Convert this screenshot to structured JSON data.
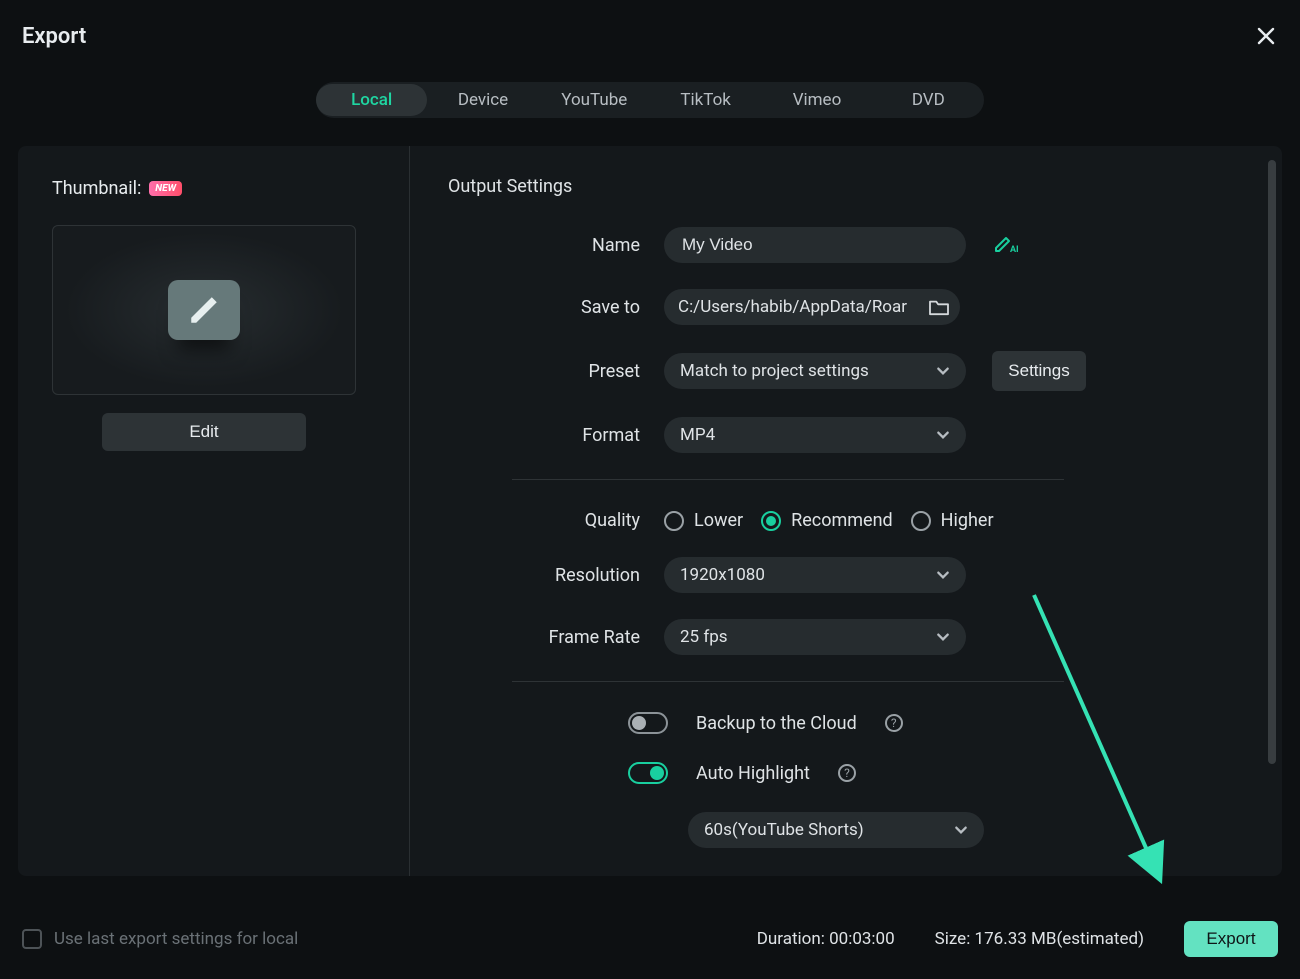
{
  "header": {
    "title": "Export"
  },
  "tabs": [
    "Local",
    "Device",
    "YouTube",
    "TikTok",
    "Vimeo",
    "DVD"
  ],
  "active_tab": "Local",
  "thumbnail": {
    "label": "Thumbnail:",
    "badge": "NEW",
    "edit_label": "Edit"
  },
  "output": {
    "section_title": "Output Settings",
    "name": {
      "label": "Name",
      "value": "My Video"
    },
    "save_to": {
      "label": "Save to",
      "value": "C:/Users/habib/AppData/Roar"
    },
    "preset": {
      "label": "Preset",
      "value": "Match to project settings",
      "settings_label": "Settings"
    },
    "format": {
      "label": "Format",
      "value": "MP4"
    },
    "quality": {
      "label": "Quality",
      "options": [
        "Lower",
        "Recommend",
        "Higher"
      ],
      "selected": "Recommend"
    },
    "resolution": {
      "label": "Resolution",
      "value": "1920x1080"
    },
    "frame_rate": {
      "label": "Frame Rate",
      "value": "25 fps"
    },
    "backup": {
      "label": "Backup to the Cloud",
      "enabled": false
    },
    "highlight": {
      "label": "Auto Highlight",
      "enabled": true,
      "preset": "60s(YouTube Shorts)"
    }
  },
  "footer": {
    "use_last_label": "Use last export settings for local",
    "duration_label": "Duration:",
    "duration_value": "00:03:00",
    "size_label": "Size:",
    "size_value": "176.33 MB(estimated)",
    "export_label": "Export"
  }
}
